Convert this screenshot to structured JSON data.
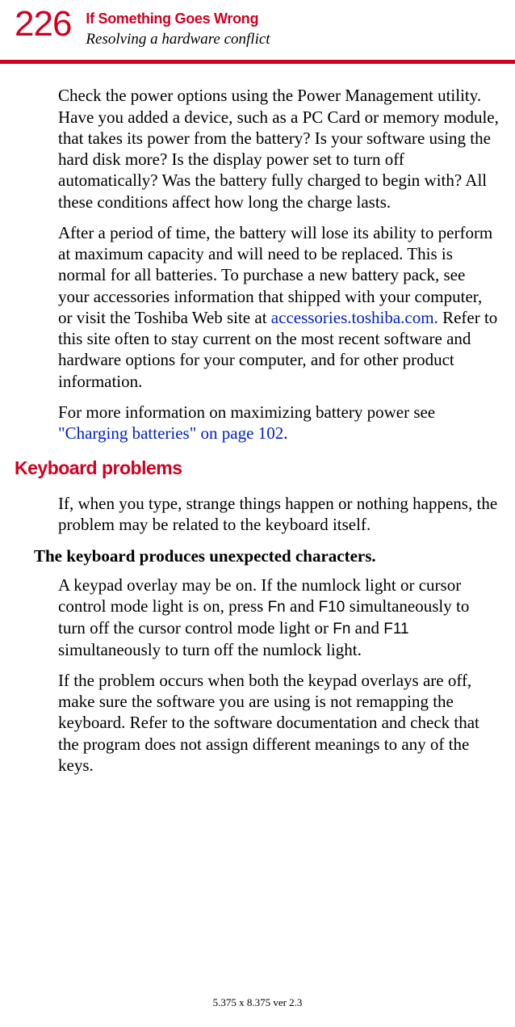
{
  "header": {
    "page_number": "226",
    "chapter_title": "If Something Goes Wrong",
    "section_title": "Resolving a hardware conflict"
  },
  "body": {
    "p1": "Check the power options using the Power Management utility. Have you added a device, such as a PC Card or memory module, that takes its power from the battery? Is your software using the hard disk more? Is the display power set to turn off automatically? Was the battery fully charged to begin with? All these conditions affect how long the charge lasts.",
    "p2a": "After a period of time, the battery will lose its ability to perform at maximum capacity and will need to be replaced. This is normal for all batteries. To purchase a new battery pack, see your accessories information that shipped with your computer, or visit the Toshiba Web site at ",
    "p2_link": "accessories.toshiba.com.",
    "p2b": " Refer to this site often to stay current on the most recent software and hardware options for your computer, and for other product information.",
    "p3a": "For more information on maximizing battery power see ",
    "p3_link": "\"Charging batteries\" on page 102",
    "p3b": ".",
    "h2": "Keyboard problems",
    "p4": "If, when you type, strange things happen or nothing happens, the problem may be related to the keyboard itself.",
    "h3": "The keyboard produces unexpected characters.",
    "p5a": "A keypad overlay may be on. If the numlock light or cursor control mode light is on, press ",
    "k_fn1": "Fn",
    "p5b": " and ",
    "k_f10": "F10",
    "p5c": " simultaneously to turn off the cursor control mode light or ",
    "k_fn2": "Fn",
    "p5d": " and ",
    "k_f11": "F11",
    "p5e": " simultaneously to turn off the numlock light.",
    "p6": "If the problem occurs when both the keypad overlays are off, make sure the software you are using is not remapping the keyboard. Refer to the software documentation and check that the program does not assign different meanings to any of the keys."
  },
  "footer": {
    "text": "5.375 x 8.375 ver 2.3"
  }
}
